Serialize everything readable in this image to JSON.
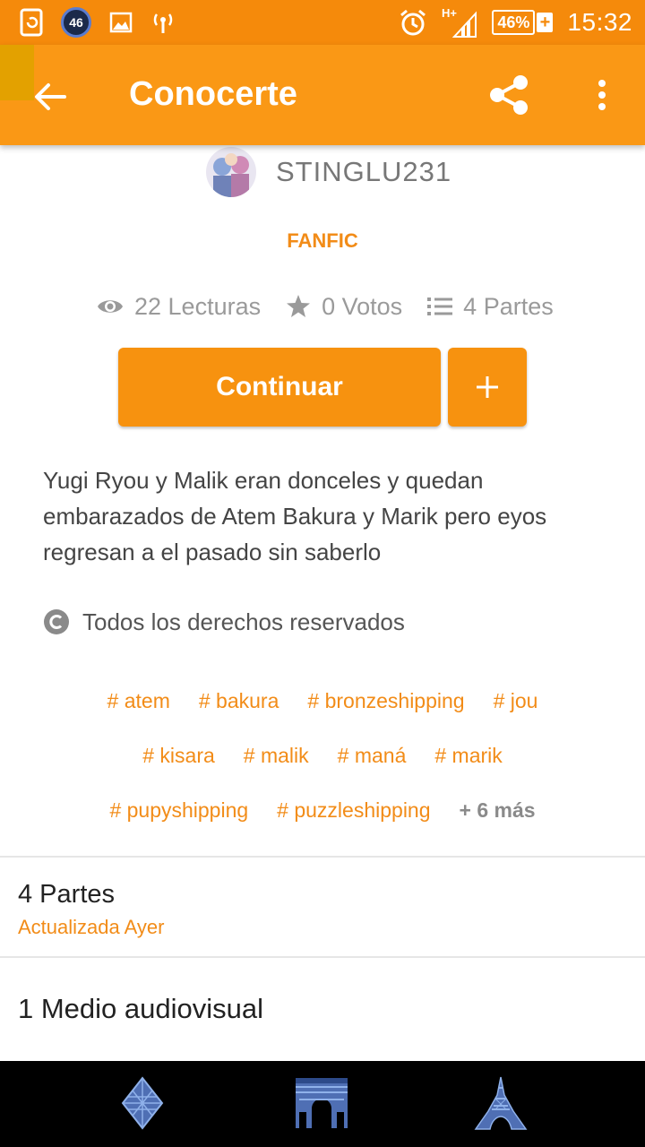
{
  "status_bar": {
    "network_badge": "46",
    "battery": "46%",
    "battery_plus": "+",
    "time": "15:32"
  },
  "app_bar": {
    "title": "Conocerte"
  },
  "story": {
    "author": "STINGLU231",
    "category": "FANFIC",
    "stats": {
      "reads": "22 Lecturas",
      "votes": "0 Votos",
      "parts": "4 Partes"
    },
    "continue_label": "Continuar",
    "add_label": "+",
    "description": "Yugi Ryou y Malik eran donceles y quedan embarazados de Atem Bakura y Marik pero eyos regresan a el pasado sin saberlo",
    "license": "Todos los derechos reservados",
    "tags_row1": [
      "# atem",
      "# bakura",
      "# bronzeshipping",
      "# jou"
    ],
    "tags_row2": [
      "# kisara",
      "# malik",
      "# maná",
      "# marik"
    ],
    "tags_row3": [
      "# pupyshipping",
      "# puzzleshipping"
    ],
    "more_tags": "+ 6 más"
  },
  "sections": {
    "parts_title": "4 Partes",
    "parts_updated": "Actualizada Ayer",
    "media_title": "1 Medio audiovisual"
  },
  "colors": {
    "status_bar": "#f58a0b",
    "app_bar": "#fa9815",
    "accent": "#f28c18",
    "button": "#f7920f"
  },
  "icons": {
    "back": "arrow-left-icon",
    "share": "share-icon",
    "more": "more-vert-icon",
    "reads": "eye-icon",
    "votes": "star-icon",
    "parts": "list-icon",
    "license": "copyright-icon",
    "nav": [
      "louvre-pyramid-icon",
      "arc-de-triomphe-icon",
      "eiffel-tower-icon"
    ]
  }
}
